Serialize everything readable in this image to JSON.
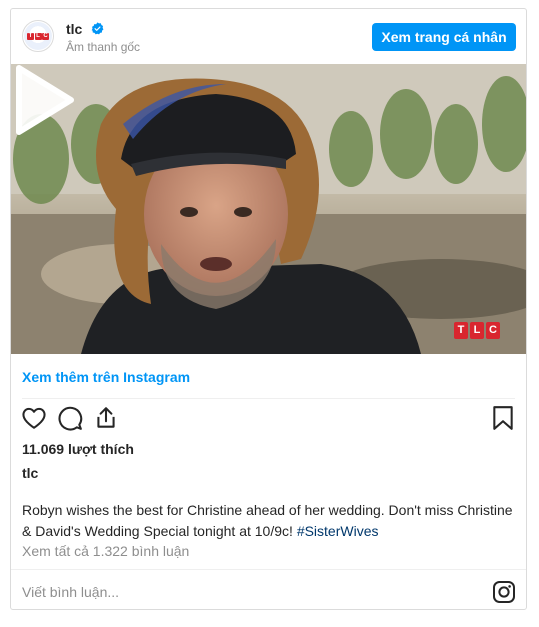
{
  "header": {
    "username": "tlc",
    "verified": true,
    "subtitle": "Âm thanh gốc",
    "profile_button": "Xem trang cá nhân",
    "avatar_letters": [
      "T",
      "L",
      "C"
    ]
  },
  "media": {
    "badge_letters": [
      "T",
      "L",
      "C"
    ],
    "play_icon": "play-icon"
  },
  "more_link": "Xem thêm trên Instagram",
  "actions": {
    "icons": [
      "heart-icon",
      "comment-icon",
      "share-icon",
      "bookmark-icon"
    ]
  },
  "likes_text": "11.069 lượt thích",
  "owner": "tlc",
  "caption": {
    "text": "Robyn wishes the best for Christine ahead of her wedding. Don't miss Christine & David's Wedding Special tonight at 10/9c!",
    "hashtag": "#SisterWives"
  },
  "comments_link": "Xem tất cả 1.322 bình luận",
  "comment_input": {
    "placeholder": "Viết bình luận..."
  },
  "colors": {
    "accent": "#0095f6",
    "brand_red": "#d9262f",
    "hashtag": "#00376b",
    "muted": "#8e8e8e"
  }
}
